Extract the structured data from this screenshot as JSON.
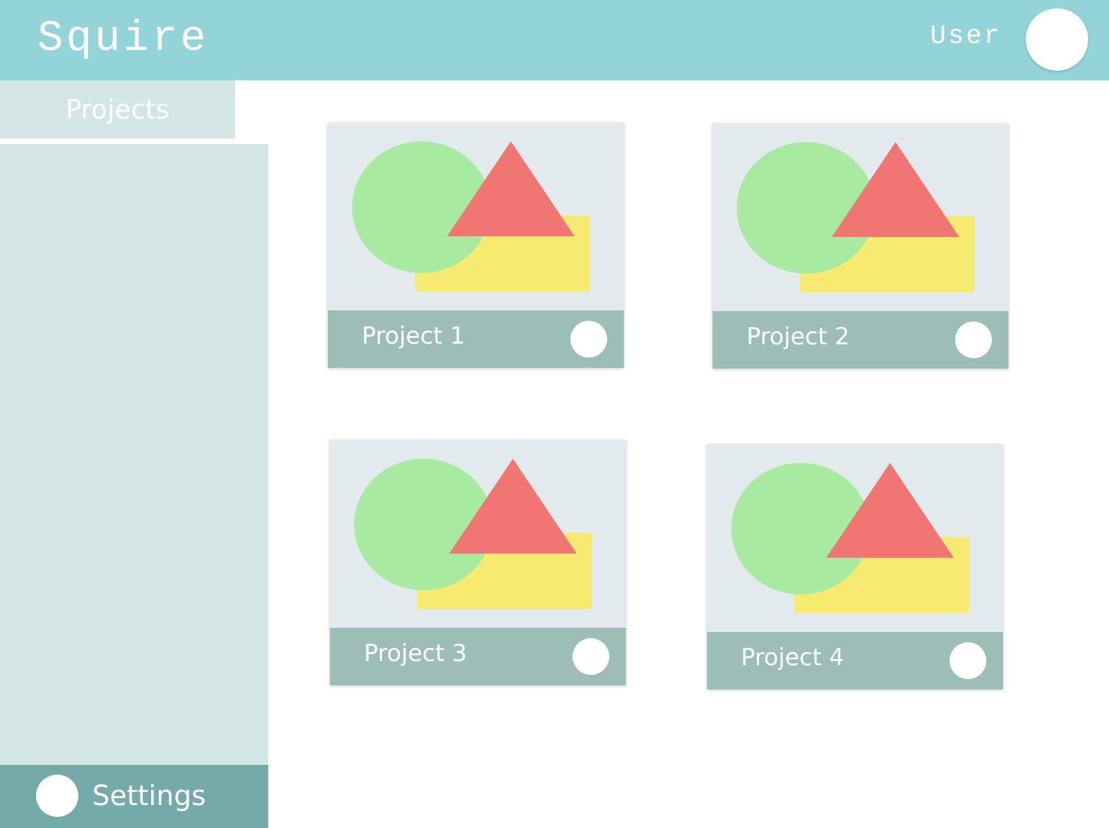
{
  "app": {
    "title": "Squire",
    "user_label": "User"
  },
  "sidebar": {
    "active_tab": "Projects",
    "settings_label": "Settings"
  },
  "projects": [
    {
      "label": "Project 1"
    },
    {
      "label": "Project 2"
    },
    {
      "label": "Project 3"
    },
    {
      "label": "Project 4"
    }
  ],
  "colors": {
    "header": "#93d4d8",
    "sidebar": "#d4e6e4",
    "settings_bar": "#74aaa9",
    "card_footer": "#9dbdb7",
    "card_thumb": "#e2eaed",
    "shape_circle": "#a8eaa0",
    "shape_rect": "#f6ea70",
    "shape_triangle": "#f07573"
  },
  "icons": {
    "avatar": "user-avatar-icon",
    "settings": "settings-icon",
    "card_action": "card-menu-icon",
    "thumbnail": "image-placeholder-icon"
  }
}
